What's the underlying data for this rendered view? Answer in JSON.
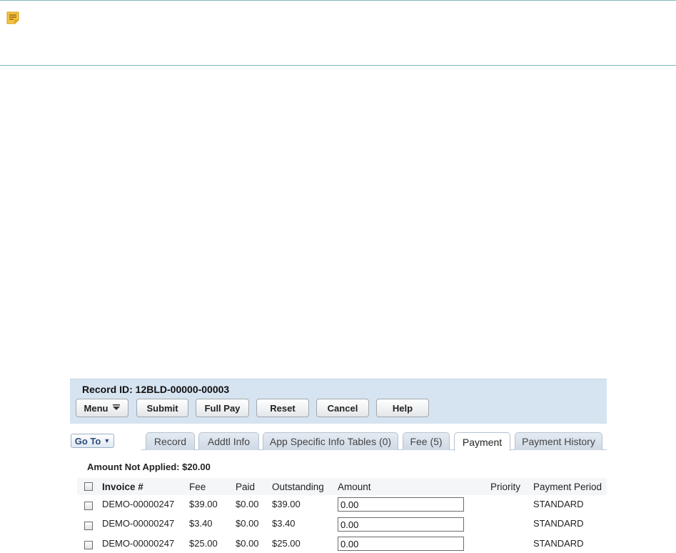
{
  "header": {
    "record_id": "Record ID: 12BLD-00000-00003"
  },
  "toolbar": {
    "menu_label": "Menu",
    "submit_label": "Submit",
    "full_pay_label": "Full Pay",
    "reset_label": "Reset",
    "cancel_label": "Cancel",
    "help_label": "Help"
  },
  "goto_label": "Go To",
  "tabs": [
    {
      "label": "Record",
      "active": false
    },
    {
      "label": "Addtl Info",
      "active": false
    },
    {
      "label": "App Specific Info Tables (0)",
      "active": false
    },
    {
      "label": "Fee (5)",
      "active": false
    },
    {
      "label": "Payment",
      "active": true
    },
    {
      "label": "Payment History",
      "active": false
    }
  ],
  "amount_not_applied": "Amount Not Applied: $20.00",
  "table": {
    "columns": [
      "Invoice #",
      "Fee",
      "Paid",
      "Outstanding",
      "Amount",
      "Priority",
      "Payment Period"
    ],
    "rows": [
      {
        "invoice": "DEMO-00000247",
        "fee": "$39.00",
        "paid": "$0.00",
        "outstanding": "$39.00",
        "amount": "0.00",
        "priority": "",
        "period": "STANDARD"
      },
      {
        "invoice": "DEMO-00000247",
        "fee": "$3.40",
        "paid": "$0.00",
        "outstanding": "$3.40",
        "amount": "0.00",
        "priority": "",
        "period": "STANDARD"
      },
      {
        "invoice": "DEMO-00000247",
        "fee": "$25.00",
        "paid": "$0.00",
        "outstanding": "$25.00",
        "amount": "0.00",
        "priority": "",
        "period": "STANDARD"
      }
    ]
  },
  "icons": {
    "note": "note-icon",
    "menu_caret": "caret-down-icon"
  },
  "colors": {
    "header_bg": "#d6e3f0",
    "note_icon": "#f2b632",
    "divider": "#7fb8bd"
  }
}
